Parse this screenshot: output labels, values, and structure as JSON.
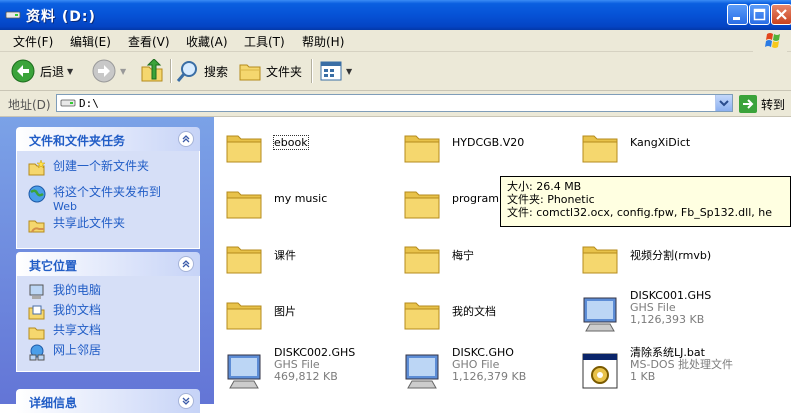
{
  "window": {
    "title": "资料  (D:)",
    "icon": "drive-icon"
  },
  "menu": [
    "文件(F)",
    "编辑(E)",
    "查看(V)",
    "收藏(A)",
    "工具(T)",
    "帮助(H)"
  ],
  "toolbar": {
    "back_label": "后退",
    "search_label": "搜索",
    "folders_label": "文件夹"
  },
  "address": {
    "label": "地址(D)",
    "value": "D:\\",
    "go_label": "转到"
  },
  "tasks_panel": {
    "title": "文件和文件夹任务",
    "items": [
      {
        "label": "创建一个新文件夹",
        "icon": "new-folder-icon"
      },
      {
        "label": "将这个文件夹发布到",
        "label2": "Web",
        "icon": "publish-web-icon"
      },
      {
        "label": "共享此文件夹",
        "icon": "share-folder-icon"
      }
    ]
  },
  "places_panel": {
    "title": "其它位置",
    "items": [
      {
        "label": "我的电脑",
        "icon": "my-computer-icon"
      },
      {
        "label": "我的文档",
        "icon": "my-documents-icon"
      },
      {
        "label": "共享文档",
        "icon": "shared-documents-icon"
      },
      {
        "label": "网上邻居",
        "icon": "network-places-icon"
      }
    ]
  },
  "details_panel": {
    "title": "详细信息"
  },
  "files": [
    {
      "name": "ebook",
      "type": "folder"
    },
    {
      "name": "HYDCGB.V20",
      "type": "folder"
    },
    {
      "name": "KangXiDict",
      "type": "folder"
    },
    {
      "name": "my music",
      "type": "folder"
    },
    {
      "name": "program f",
      "type": "folder"
    },
    {
      "name": "课件",
      "type": "folder"
    },
    {
      "name": "梅宁",
      "type": "folder"
    },
    {
      "name": "视频分割(rmvb)",
      "type": "folder"
    },
    {
      "name": "图片",
      "type": "folder"
    },
    {
      "name": "我的文档",
      "type": "folder"
    },
    {
      "name": "DISKC001.GHS",
      "type": "file",
      "kind": "GHS File",
      "size": "1,126,393 KB",
      "icon": "ghost-file-icon"
    },
    {
      "name": "DISKC002.GHS",
      "type": "file",
      "kind": "GHS File",
      "size": "469,812 KB",
      "icon": "ghost-file-icon"
    },
    {
      "name": "DISKC.GHO",
      "type": "file",
      "kind": "GHO File",
      "size": "1,126,379 KB",
      "icon": "ghost-file-icon"
    },
    {
      "name": "清除系统LJ.bat",
      "type": "file",
      "kind": "MS-DOS 批处理文件",
      "size": "1 KB",
      "icon": "batch-file-icon"
    }
  ],
  "tooltip": {
    "size_line": "大小: 26.4 MB",
    "folders_line": "文件夹: Phonetic",
    "files_line": "文件: comctl32.ocx, config.fpw, Fb_Sp132.dll, he"
  },
  "colors": {
    "titlebar": "#0652d6",
    "task_link": "#215dc6",
    "folder": "#f5d76e"
  }
}
